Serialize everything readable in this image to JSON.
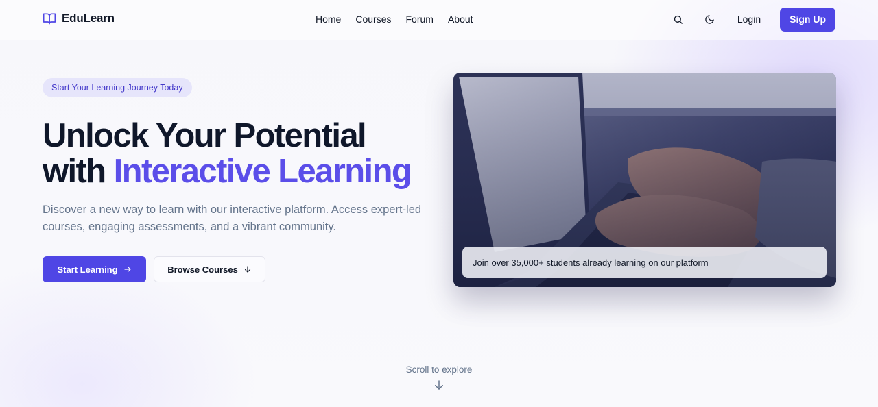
{
  "brand": {
    "name": "EduLearn",
    "icon": "book-open-icon"
  },
  "nav": {
    "links": [
      "Home",
      "Courses",
      "Forum",
      "About"
    ],
    "login": "Login",
    "signup": "Sign Up",
    "search_icon": "search-icon",
    "theme_icon": "moon-icon"
  },
  "hero": {
    "badge": "Start Your Learning Journey Today",
    "headline_line1": "Unlock Your Potential",
    "headline_line2_prefix": "with ",
    "headline_line2_accent": "Interactive Learning",
    "subtext": "Discover a new way to learn with our interactive platform. Access expert-led courses, engaging assessments, and a vibrant community.",
    "primary_cta": "Start Learning",
    "secondary_cta": "Browse Courses",
    "image_caption": "Join over 35,000+ students already learning on our platform"
  },
  "scroll": {
    "text": "Scroll to explore"
  },
  "colors": {
    "accent": "#4f46e5",
    "accent_text": "#5b4ee9",
    "muted": "#64748b"
  }
}
